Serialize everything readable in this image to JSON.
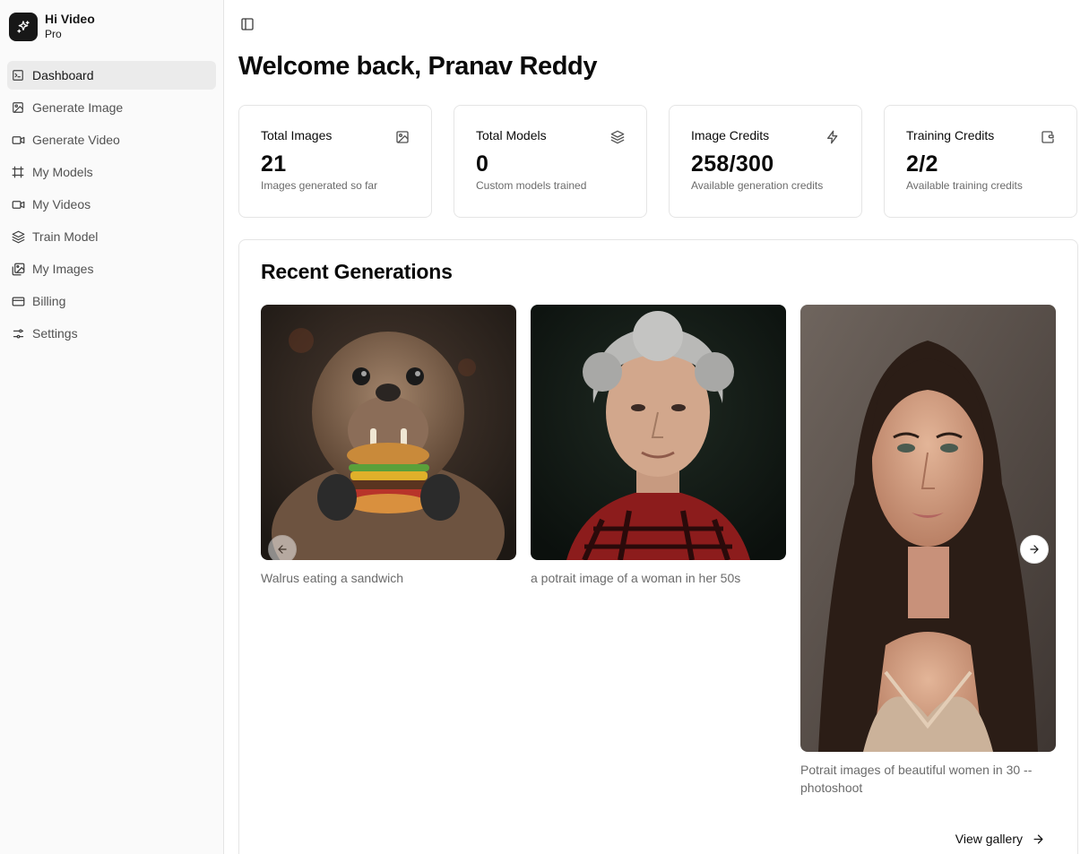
{
  "brand": {
    "name": "Hi Video",
    "plan": "Pro"
  },
  "sidebar": {
    "items": [
      {
        "label": "Dashboard",
        "icon": "terminal-icon",
        "active": true
      },
      {
        "label": "Generate Image",
        "icon": "image-icon"
      },
      {
        "label": "Generate Video",
        "icon": "video-icon"
      },
      {
        "label": "My Models",
        "icon": "frame-icon"
      },
      {
        "label": "My Videos",
        "icon": "video-icon"
      },
      {
        "label": "Train Model",
        "icon": "layers-icon"
      },
      {
        "label": "My Images",
        "icon": "images-icon"
      },
      {
        "label": "Billing",
        "icon": "credit-card-icon"
      },
      {
        "label": "Settings",
        "icon": "settings-icon"
      }
    ]
  },
  "page": {
    "title": "Welcome back, Pranav Reddy"
  },
  "stats": [
    {
      "label": "Total Images",
      "value": "21",
      "sub": "Images generated so far",
      "icon": "image-icon"
    },
    {
      "label": "Total Models",
      "value": "0",
      "sub": "Custom models trained",
      "icon": "layers-icon"
    },
    {
      "label": "Image Credits",
      "value": "258/300",
      "sub": "Available generation credits",
      "icon": "zap-icon"
    },
    {
      "label": "Training Credits",
      "value": "2/2",
      "sub": "Available training credits",
      "icon": "wallet-icon"
    }
  ],
  "recent": {
    "title": "Recent Generations",
    "items": [
      {
        "caption": "Walrus eating a sandwich"
      },
      {
        "caption": "a potrait image of a woman in her 50s"
      },
      {
        "caption": "Potrait images of beautiful women in 30 -- photoshoot"
      }
    ],
    "view_gallery": "View gallery"
  }
}
